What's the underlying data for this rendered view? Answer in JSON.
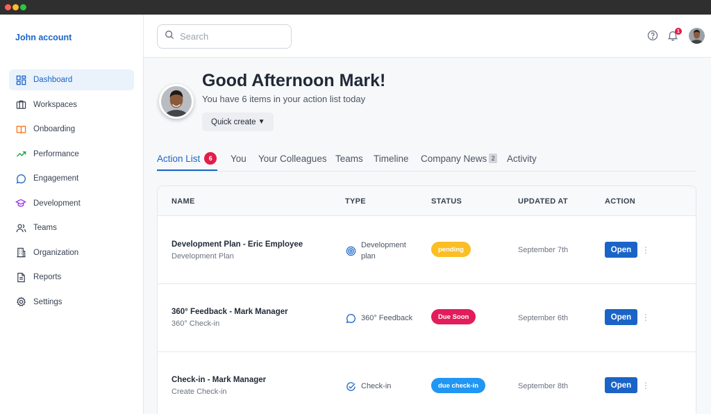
{
  "sidebar": {
    "account": "John account",
    "items": [
      {
        "label": "Dashboard",
        "icon": "dashboard-icon",
        "active": true
      },
      {
        "label": "Workspaces",
        "icon": "briefcase-icon"
      },
      {
        "label": "Onboarding",
        "icon": "book-icon"
      },
      {
        "label": "Performance",
        "icon": "trend-up-icon"
      },
      {
        "label": "Engagement",
        "icon": "chat-icon"
      },
      {
        "label": "Development",
        "icon": "graduation-cap-icon"
      },
      {
        "label": "Teams",
        "icon": "users-icon"
      },
      {
        "label": "Organization",
        "icon": "building-icon"
      },
      {
        "label": "Reports",
        "icon": "document-icon"
      },
      {
        "label": "Settings",
        "icon": "gear-icon"
      }
    ]
  },
  "topbar": {
    "search_placeholder": "Search",
    "notification_count": "1"
  },
  "hero": {
    "greeting": "Good Afternoon Mark!",
    "subtitle": "You have 6 items in your action list today",
    "quick_create": "Quick create",
    "quick_create_arrow": "▼"
  },
  "tabs": [
    {
      "label": "Action List",
      "count": "6",
      "active": true
    },
    {
      "label": "You"
    },
    {
      "label": "Your Colleagues"
    },
    {
      "label": "Teams"
    },
    {
      "label": "Timeline"
    },
    {
      "label": "Company News",
      "count": "2"
    },
    {
      "label": "Activity"
    }
  ],
  "table": {
    "headers": [
      "NAME",
      "TYPE",
      "STATUS",
      "UPDATED AT",
      "ACTION"
    ],
    "rows": [
      {
        "name": "Development Plan - Eric Employee",
        "sub": "Development Plan",
        "type_line1": "Development",
        "type_line2": "plan",
        "type_icon": "target-icon",
        "status": "pending",
        "status_color": "#fbbf24",
        "updated": "September 7th",
        "action": "Open"
      },
      {
        "name": "360° Feedback - Mark Manager",
        "sub": "360° Check-in",
        "type_line1": "360° Feedback",
        "type_line2": "",
        "type_icon": "chat-icon",
        "status": "Due Soon",
        "status_color": "#e11d5b",
        "updated": "September 6th",
        "action": "Open"
      },
      {
        "name": "Check-in - Mark Manager",
        "sub": "Create Check-in",
        "type_line1": "Check-in",
        "type_line2": "",
        "type_icon": "check-circle-icon",
        "status": "due check-in",
        "status_color": "#2196f3",
        "updated": "September 8th",
        "action": "Open"
      }
    ]
  },
  "colors": {
    "accent": "#1a64c8",
    "active_nav_bg": "#eaf2fb",
    "badge_red": "#e11d48"
  }
}
